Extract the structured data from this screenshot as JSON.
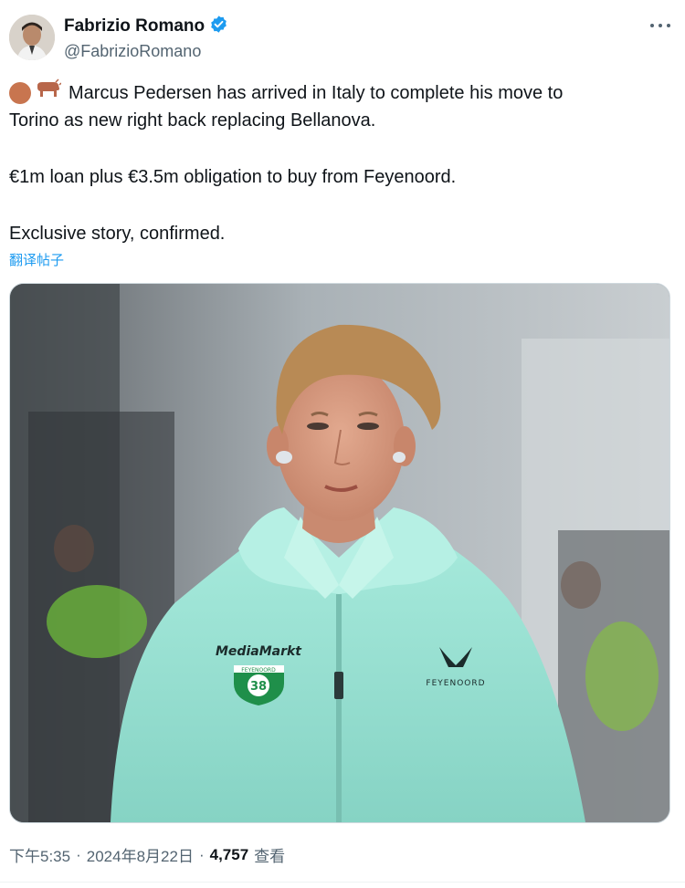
{
  "author": {
    "display_name": "Fabrizio Romano",
    "handle": "@FabrizioRomano",
    "verified": true
  },
  "tweet": {
    "line1": "Marcus Pedersen has arrived in Italy to complete his move to",
    "line1b": "Torino as new right back replacing Bellanova.",
    "line2": "€1m loan plus €3.5m obligation to buy from Feyenoord.",
    "line3": "Exclusive story, confirmed.",
    "emojis": [
      "brown-circle-emoji",
      "ox-emoji"
    ]
  },
  "translate_label": "翻译帖子",
  "photo": {
    "sponsor_text": "MediaMarkt",
    "badge_top": "FEYENOORD",
    "badge_number": "38",
    "brand_text": "FEYENOORD"
  },
  "meta": {
    "time": "下午5:35",
    "date": "2024年8月22日",
    "views_count": "4,757",
    "views_label": "查看"
  },
  "colors": {
    "accent": "#1d9bf0",
    "verified_badge": "#1d9bf0",
    "text_primary": "#0f1419",
    "text_secondary": "#536471",
    "jacket": "#9fe3d6"
  }
}
